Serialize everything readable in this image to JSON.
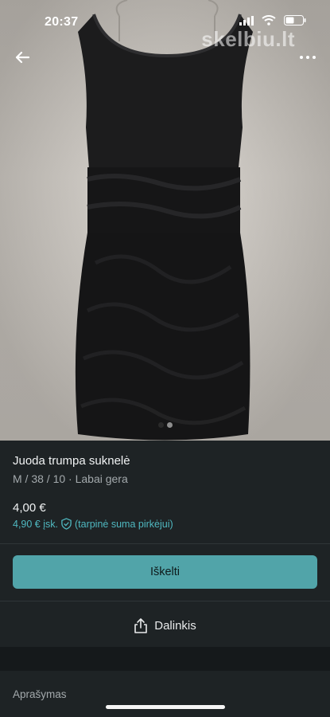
{
  "status": {
    "time": "20:37"
  },
  "watermark": "skelbiu.lt",
  "gallery": {
    "pages": 2,
    "active": 0
  },
  "listing": {
    "title": "Juoda trumpa suknelė",
    "attributes": "M / 38 / 10 · Labai gera",
    "price": "4,00 €",
    "price_incl": "4,90 € įsk.",
    "price_note": "(tarpinė suma pirkėjui)"
  },
  "actions": {
    "buy_label": "Iškelti",
    "share_label": "Dalinkis"
  },
  "description_heading": "Aprašymas",
  "colors": {
    "accent": "#51a4a9",
    "link": "#4fb8c0",
    "background": "#1e2325"
  }
}
